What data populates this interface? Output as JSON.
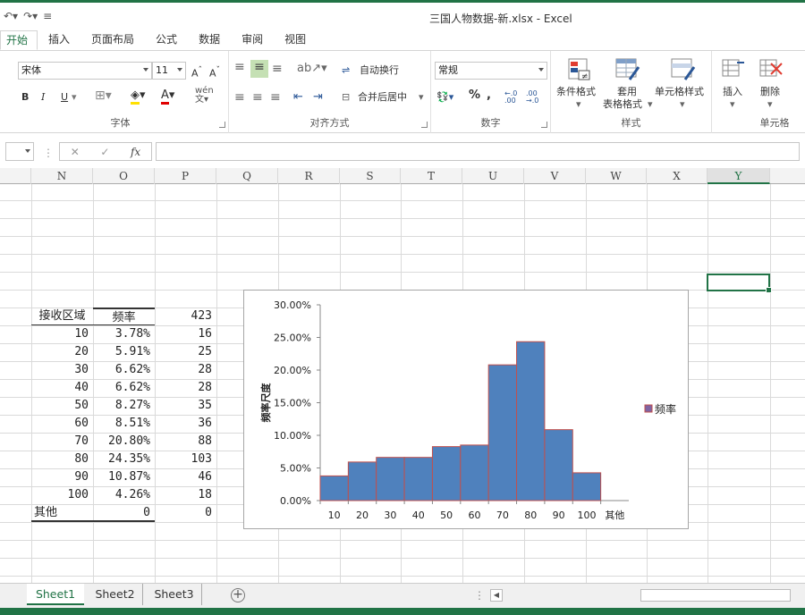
{
  "window": {
    "title": "三国人物数据-新.xlsx - Excel"
  },
  "ribbon_tabs": [
    "开始",
    "插入",
    "页面布局",
    "公式",
    "数据",
    "审阅",
    "视图"
  ],
  "ribbon": {
    "font_name": "宋体",
    "font_size": "11",
    "bold": "B",
    "italic": "I",
    "underline": "U",
    "font_group_label": "字体",
    "wrap_text": "自动换行",
    "merge_center": "合并后居中",
    "align_group_label": "对齐方式",
    "number_format": "常规",
    "percent": "%",
    "comma": ",",
    "inc_decimal": "←.0 .00",
    "dec_decimal": ".00 →.0",
    "number_group_label": "数字",
    "conditional_format": "条件格式",
    "table_format_1": "套用",
    "table_format_2": "表格格式",
    "cell_styles": "单元格样式",
    "styles_group_label": "样式",
    "insert": "插入",
    "delete": "删除",
    "cells_group_label": "单元格"
  },
  "formula_bar": {
    "fx": "fx",
    "cancel": "✕",
    "confirm": "✓"
  },
  "columns": [
    "N",
    "O",
    "P",
    "Q",
    "R",
    "S",
    "T",
    "U",
    "V",
    "W",
    "X",
    "Y"
  ],
  "selected_column": "Y",
  "table": {
    "header_bin": "接收区域",
    "header_freq": "频率",
    "header_count": "423",
    "rows": [
      {
        "bin": "10",
        "freq": "3.78%",
        "count": "16"
      },
      {
        "bin": "20",
        "freq": "5.91%",
        "count": "25"
      },
      {
        "bin": "30",
        "freq": "6.62%",
        "count": "28"
      },
      {
        "bin": "40",
        "freq": "6.62%",
        "count": "28"
      },
      {
        "bin": "50",
        "freq": "8.27%",
        "count": "35"
      },
      {
        "bin": "60",
        "freq": "8.51%",
        "count": "36"
      },
      {
        "bin": "70",
        "freq": "20.80%",
        "count": "88"
      },
      {
        "bin": "80",
        "freq": "24.35%",
        "count": "103"
      },
      {
        "bin": "90",
        "freq": "10.87%",
        "count": "46"
      },
      {
        "bin": "100",
        "freq": "4.26%",
        "count": "18"
      },
      {
        "bin": "其他",
        "freq": "0",
        "count": "0"
      }
    ]
  },
  "chart_data": {
    "type": "bar",
    "categories": [
      "10",
      "20",
      "30",
      "40",
      "50",
      "60",
      "70",
      "80",
      "90",
      "100",
      "其他"
    ],
    "series": [
      {
        "name": "频率",
        "values": [
          3.78,
          5.91,
          6.62,
          6.62,
          8.27,
          8.51,
          20.8,
          24.35,
          10.87,
          4.26,
          0
        ]
      }
    ],
    "title": "",
    "xlabel": "",
    "ylabel": "频率尺度",
    "ylim": [
      0,
      30
    ],
    "yticks": [
      "0.00%",
      "5.00%",
      "10.00%",
      "15.00%",
      "20.00%",
      "25.00%",
      "30.00%"
    ],
    "grid": false,
    "legend": "right",
    "bar_color": "#4f81bd",
    "bar_border": "#c0504d",
    "legend_color": "#8064a2"
  },
  "sheets": [
    "Sheet1",
    "Sheet2",
    "Sheet3"
  ],
  "active_sheet": "Sheet1",
  "accent": "#217346"
}
